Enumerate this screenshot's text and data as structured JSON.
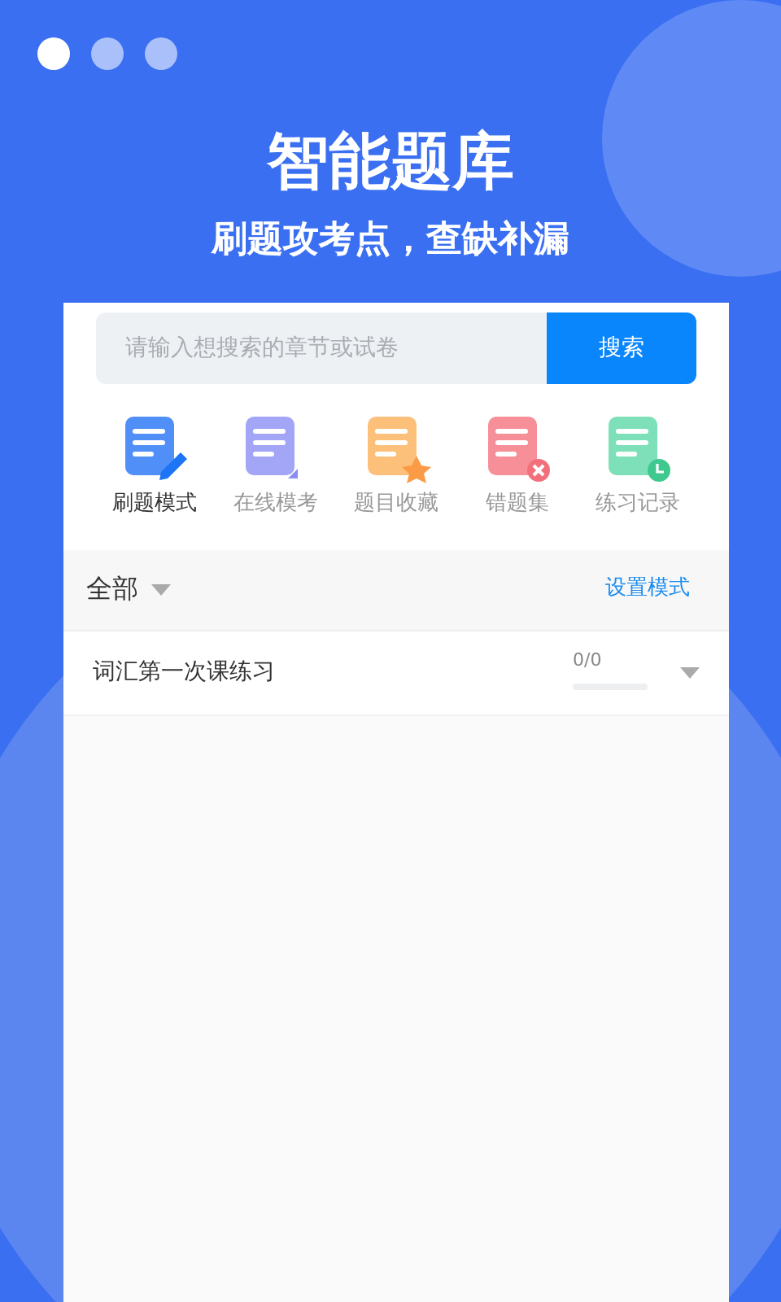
{
  "page_dots": [
    {
      "selected": true
    },
    {
      "selected": false
    },
    {
      "selected": false
    }
  ],
  "headline": "智能题库",
  "subheadline": "刷题攻考点，查缺补漏",
  "search": {
    "placeholder": "请输入想搜索的章节或试卷",
    "button": "搜索"
  },
  "modes": [
    {
      "label": "刷题模式",
      "kind": "pen",
      "selected": true
    },
    {
      "label": "在线模考",
      "kind": "doc",
      "selected": false
    },
    {
      "label": "题目收藏",
      "kind": "star",
      "selected": false
    },
    {
      "label": "错题集",
      "kind": "cross",
      "selected": false
    },
    {
      "label": "练习记录",
      "kind": "clock",
      "selected": false
    }
  ],
  "filter": {
    "label": "全部",
    "action": "设置模式"
  },
  "chapters": [
    {
      "title": "词汇第一次课练习",
      "progress": "0/0"
    }
  ]
}
